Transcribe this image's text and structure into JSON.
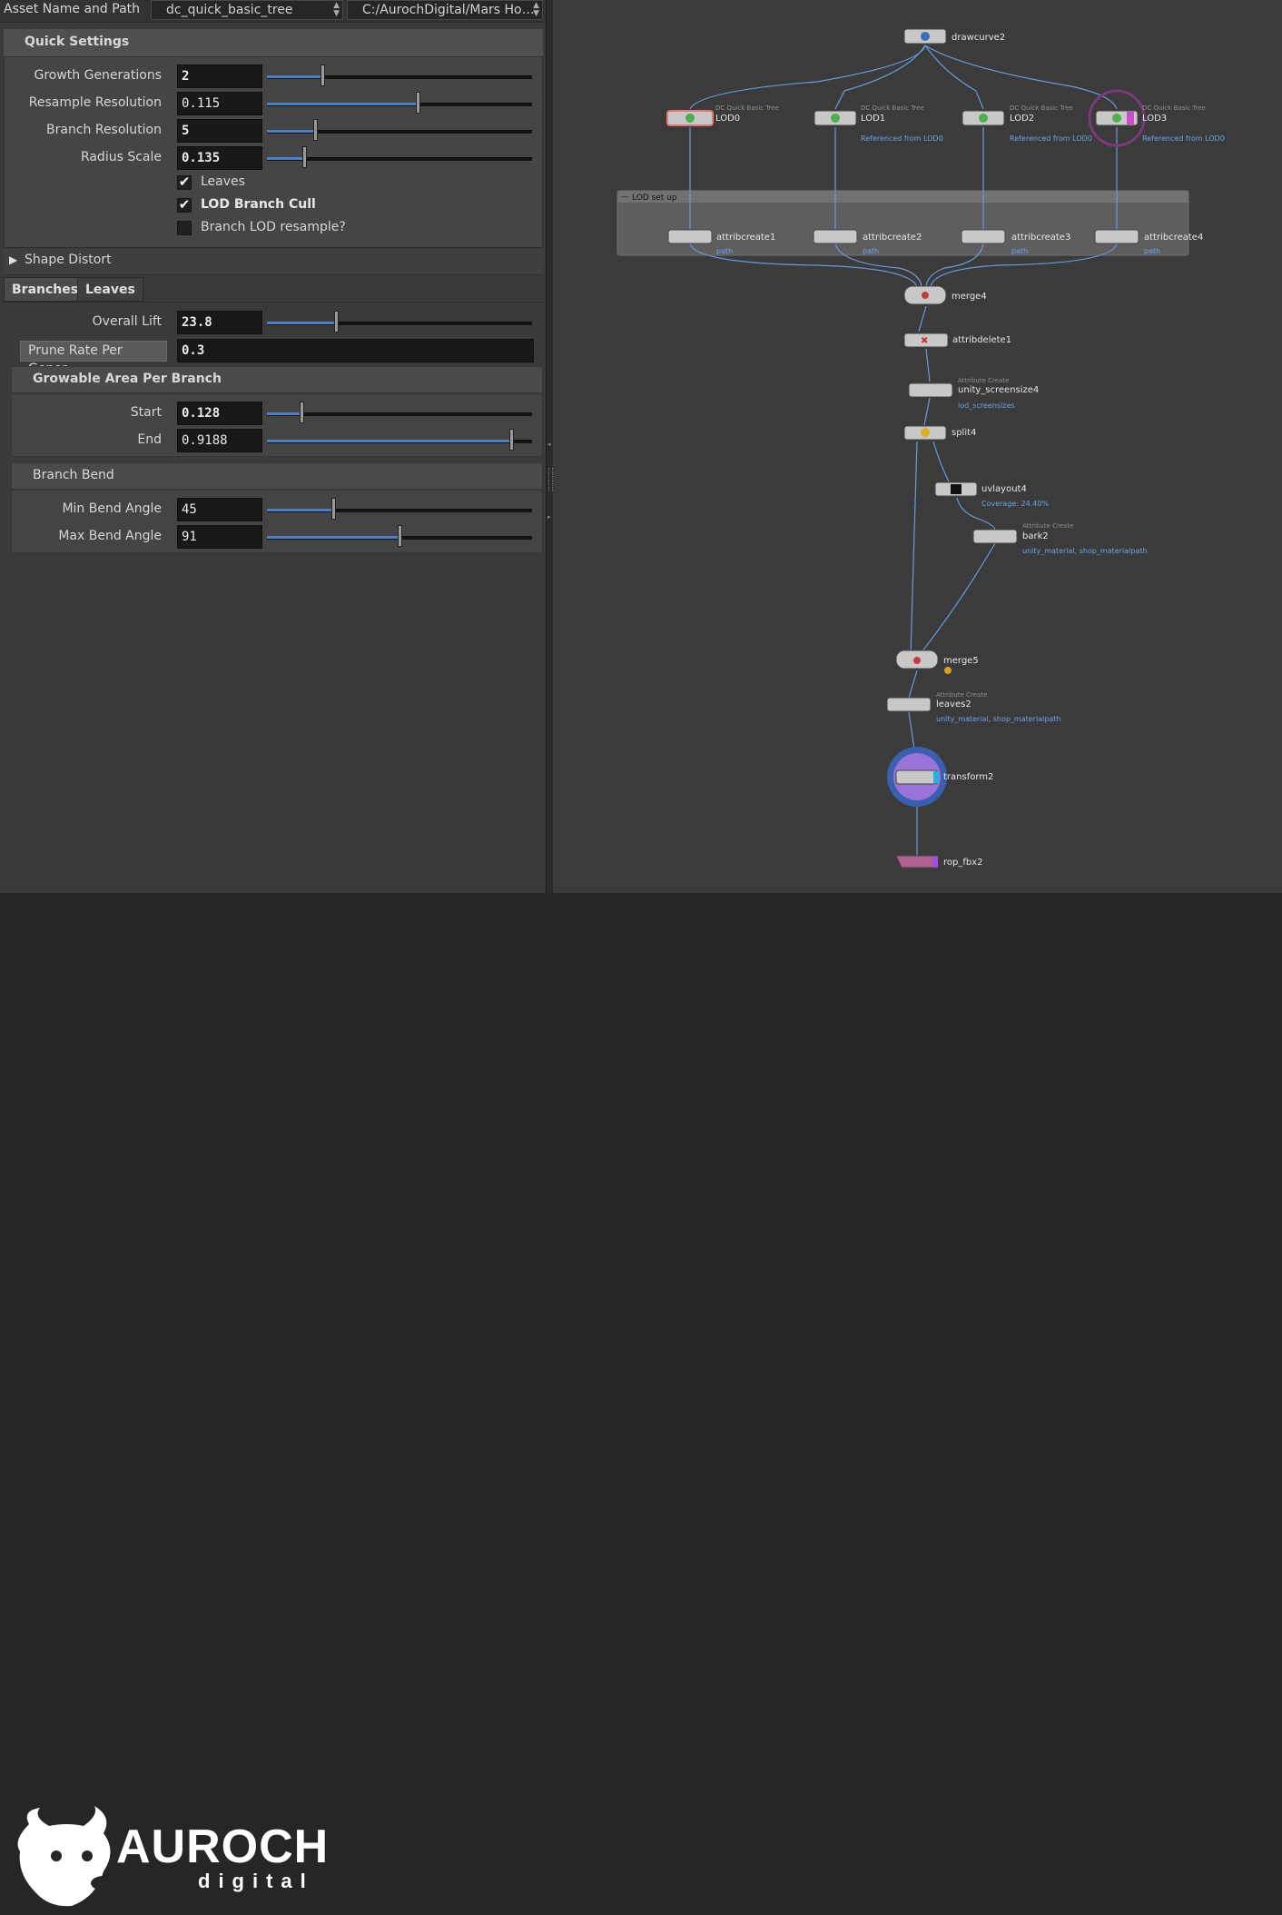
{
  "top_bar": {
    "label": "Asset Name and Path",
    "asset_name": "dc_quick_basic_tree",
    "asset_path": "C:/AurochDigital/Mars Ho…"
  },
  "quick_settings": {
    "title": "Quick Settings",
    "growth_generations": {
      "label": "Growth Generations",
      "value": "2",
      "fraction": 0.21
    },
    "resample_resolution": {
      "label": "Resample Resolution",
      "value": "0.115",
      "fraction": 0.57
    },
    "branch_resolution": {
      "label": "Branch Resolution",
      "value": "5",
      "fraction": 0.18
    },
    "radius_scale": {
      "label": "Radius Scale",
      "value": "0.135",
      "fraction": 0.14
    },
    "leaves": {
      "label": "Leaves",
      "checked": true
    },
    "lod_branch_cull": {
      "label": "LOD Branch Cull",
      "checked": true
    },
    "branch_lod_resample": {
      "label": "Branch LOD resample?",
      "checked": false
    }
  },
  "shape_distort": {
    "label": "Shape Distort"
  },
  "tabs": [
    "Branches",
    "Leaves"
  ],
  "branches": {
    "overall_lift": {
      "label": "Overall Lift",
      "value": "23.8",
      "fraction": 0.26
    },
    "prune_rate": {
      "label": "Prune Rate Per Gener…",
      "value": "0.3"
    },
    "growable_area": {
      "title": "Growable Area Per Branch",
      "start": {
        "label": "Start",
        "value": "0.128",
        "fraction": 0.13
      },
      "end": {
        "label": "End",
        "value": "0.9188",
        "fraction": 0.92
      }
    },
    "branch_bend": {
      "title": "Branch Bend",
      "min_bend": {
        "label": "Min Bend Angle",
        "value": "45",
        "fraction": 0.25
      },
      "max_bend": {
        "label": "Max Bend Angle",
        "value": "91",
        "fraction": 0.5
      }
    }
  },
  "network": {
    "group_label": "LOD set up",
    "nodes": {
      "drawcurve": {
        "name": "drawcurve2"
      },
      "lod0": {
        "name": "LOD0",
        "type": "DC Quick Basic Tree"
      },
      "lod1": {
        "name": "LOD1",
        "type": "DC Quick Basic Tree",
        "sub": "Referenced from LOD0"
      },
      "lod2": {
        "name": "LOD2",
        "type": "DC Quick Basic Tree",
        "sub": "Referenced from LOD0"
      },
      "lod3": {
        "name": "LOD3",
        "type": "DC Quick Basic Tree",
        "sub": "Referenced from LOD0"
      },
      "attribcreate1": {
        "name": "attribcreate1",
        "sub": "path"
      },
      "attribcreate2": {
        "name": "attribcreate2",
        "sub": "path"
      },
      "attribcreate3": {
        "name": "attribcreate3",
        "sub": "path"
      },
      "attribcreate4": {
        "name": "attribcreate4",
        "sub": "path"
      },
      "merge4": {
        "name": "merge4"
      },
      "attribdelete": {
        "name": "attribdelete1"
      },
      "unity_screensize": {
        "name": "unity_screensize4",
        "type": "Attribute Create",
        "sub": "lod_screensizes"
      },
      "split": {
        "name": "split4"
      },
      "uvlayout": {
        "name": "uvlayout4",
        "sub": "Coverage: 24.40%"
      },
      "bark": {
        "name": "bark2",
        "type": "Attribute Create",
        "sub": "unity_material, shop_materialpath"
      },
      "merge5": {
        "name": "merge5"
      },
      "leaves": {
        "name": "leaves2",
        "type": "Attribute Create",
        "sub": "unity_material, shop_materialpath"
      },
      "transform": {
        "name": "transform2"
      },
      "rop_fbx": {
        "name": "rop_fbx2"
      }
    }
  },
  "brand": {
    "name": "AUROCH",
    "tagline": "digital"
  },
  "colors": {
    "accent_blue": "#4d7fc2",
    "wire": "#6a9ad6",
    "node_sub": "#6ea3e8",
    "lod3_ring": "#7a3a7a",
    "display_ring": "#4a6ad0"
  }
}
